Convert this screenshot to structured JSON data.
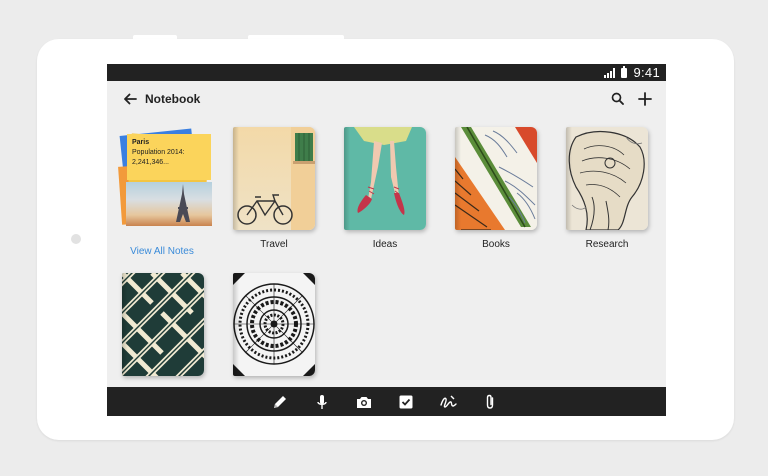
{
  "status_bar": {
    "time": "9:41"
  },
  "app_bar": {
    "title": "Notebook",
    "back_icon": "arrow-left-icon",
    "search_icon": "search-icon",
    "add_icon": "plus-icon"
  },
  "notes_card": {
    "note_title": "Paris",
    "note_line1": "Population 2014:",
    "note_line2": "2,241,346...",
    "link_label": "View All Notes"
  },
  "notebooks": [
    {
      "label": "Travel"
    },
    {
      "label": "Ideas"
    },
    {
      "label": "Books"
    },
    {
      "label": "Research"
    },
    {
      "label": ""
    },
    {
      "label": ""
    }
  ],
  "toolbar": {
    "tools": [
      "pencil-icon",
      "microphone-icon",
      "camera-icon",
      "checkbox-icon",
      "handwriting-icon",
      "paperclip-icon"
    ]
  },
  "colors": {
    "bar_dark": "#222222",
    "link_blue": "#3a8bd9",
    "screen_bg": "#efefef"
  }
}
